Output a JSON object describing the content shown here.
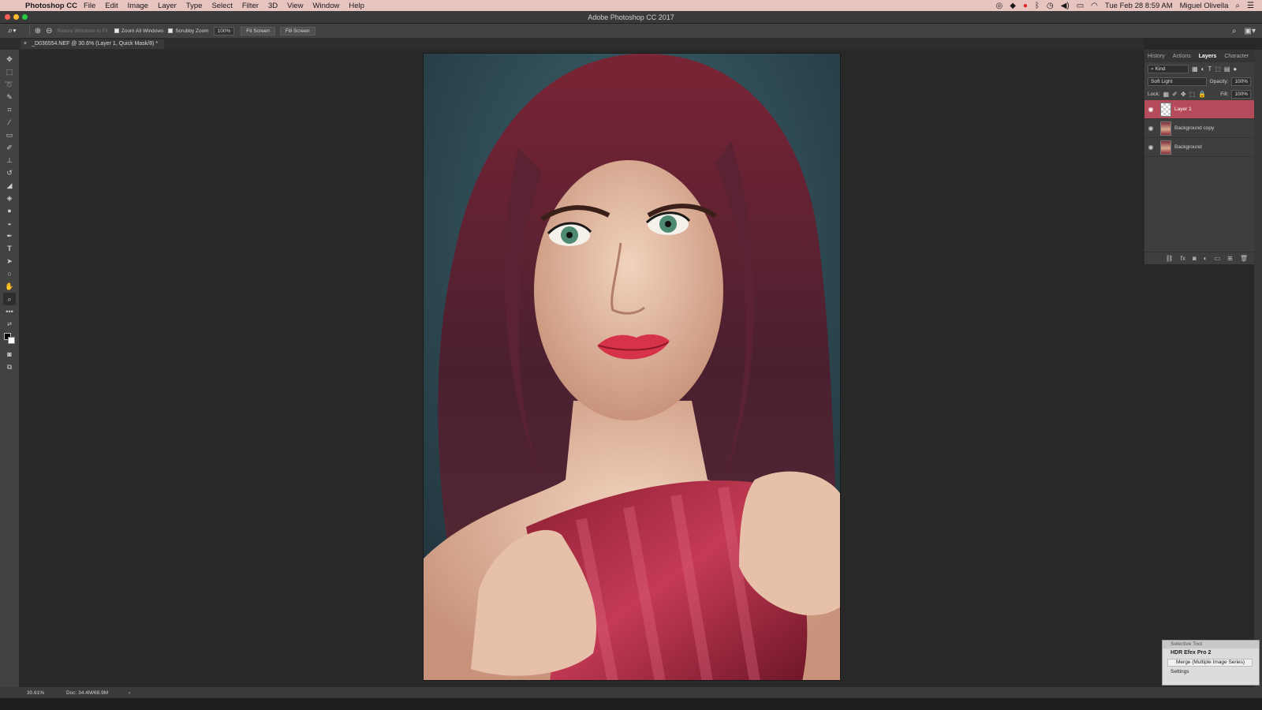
{
  "menubar": {
    "app_name": "Photoshop CC",
    "items": [
      "File",
      "Edit",
      "Image",
      "Layer",
      "Type",
      "Select",
      "Filter",
      "3D",
      "View",
      "Window",
      "Help"
    ],
    "datetime": "Tue Feb 28  8:59 AM",
    "user": "Miguel Olivella"
  },
  "window": {
    "title": "Adobe Photoshop CC 2017"
  },
  "options": {
    "resize_windows": "Resize Windows to Fit",
    "zoom_all_windows": "Zoom All Windows",
    "scrubby_zoom": "Scrubby Zoom",
    "zoom_value": "100%",
    "fit_screen": "Fit Screen",
    "fill_screen": "Fill Screen"
  },
  "document": {
    "tab_title": "_D036554.NEF @ 30.6% (Layer 1, Quick Mask/8) *",
    "close_glyph": "×"
  },
  "status": {
    "zoom": "30.61%",
    "doc_size": "Doc: 34.4M/68.9M",
    "arrow": "›"
  },
  "panel": {
    "tabs": [
      "History",
      "Actions",
      "Layers",
      "Character"
    ],
    "active_tab": "Layers",
    "kind_filter": "Kind",
    "blend_mode": "Soft Light",
    "opacity_label": "Opacity:",
    "opacity_value": "100%",
    "lock_label": "Lock:",
    "fill_label": "Fill:",
    "fill_value": "100%",
    "layers": [
      {
        "name": "Layer 1",
        "selected": true,
        "thumb": "checker"
      },
      {
        "name": "Background copy",
        "selected": false,
        "thumb": "photo"
      },
      {
        "name": "Background",
        "selected": false,
        "thumb": "photo"
      }
    ]
  },
  "selective_tool": {
    "title": "Selective Tool",
    "header": "HDR Efex Pro 2",
    "option": "Merge (Multiple Image Series)",
    "settings": "Settings"
  },
  "colors": {
    "menubar_bg": "#e8c4c0",
    "selected_layer": "#b54b5a",
    "canvas_bg": "#282828"
  }
}
